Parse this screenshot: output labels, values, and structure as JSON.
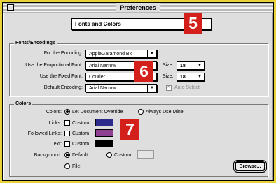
{
  "window": {
    "title": "Preferences"
  },
  "section": {
    "selected": "Fonts and Colors"
  },
  "fonts": {
    "group_title": "Fonts/Encodings",
    "encoding_label": "For the Encoding:",
    "encoding_value": "AppleGaramond Bk",
    "proportional_label": "Use the Proportional Font:",
    "proportional_value": "Arial Narrow",
    "proportional_size_label": "Size:",
    "proportional_size": "18",
    "fixed_label": "Use the Fixed Font:",
    "fixed_value": "Courier",
    "fixed_size_label": "Size:",
    "fixed_size": "18",
    "default_encoding_label": "Default Encoding:",
    "default_encoding_value": "Arial Narrow",
    "auto_select_label": "Auto Select"
  },
  "colors": {
    "group_title": "Colors",
    "colors_label": "Colors:",
    "option_override": "Let Document Override",
    "option_always": "Always Use Mine",
    "links_label": "Links:",
    "followed_label": "Followed Links:",
    "text_label": "Text:",
    "custom_label": "Custom",
    "links_color": "#2c2a8a",
    "followed_color": "#8e3f92",
    "text_color": "#000000",
    "background_label": "Background:",
    "bg_default": "Default",
    "bg_custom": "Custom",
    "bg_file": "File:",
    "browse_label": "Browse..."
  },
  "callouts": {
    "five": "5",
    "six": "6",
    "seven": "7"
  }
}
